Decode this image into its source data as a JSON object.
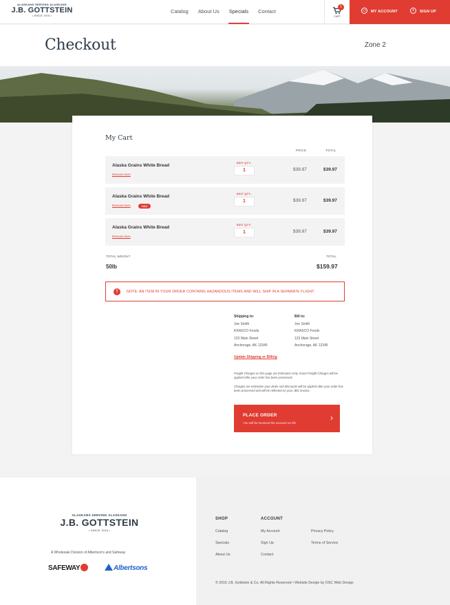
{
  "header": {
    "logo": {
      "tagline": "ALASKANS SERVING ALASKANS",
      "name": "J.B. GOTTSTEIN",
      "since": "• SINCE 1916 •"
    },
    "nav": [
      {
        "label": "Catalog",
        "active": false
      },
      {
        "label": "About Us",
        "active": false
      },
      {
        "label": "Specials",
        "active": true
      },
      {
        "label": "Contact",
        "active": false
      }
    ],
    "cart": {
      "count": "1",
      "label": "CART",
      "icon": "cart-icon"
    },
    "my_account": {
      "label": "MY ACCOUNT",
      "icon": "user-icon"
    },
    "sign_up": {
      "label": "SIGN UP",
      "icon": "plus-circle-icon"
    },
    "accent_color": "#e03c31"
  },
  "page": {
    "title": "Checkout",
    "zone": "Zone 2"
  },
  "cart": {
    "title": "My Cart",
    "columns": {
      "price": "PRICE",
      "total": "TOTAL"
    },
    "items": [
      {
        "name": "Alaska Grains White Bread",
        "remove": "Remove Item",
        "qty_label": "EDIT QTY:",
        "qty": "1",
        "price": "$39.97",
        "total": "$39.97",
        "haz": ""
      },
      {
        "name": "Alaska Grains White Bread",
        "remove": "Remove Item",
        "qty_label": "EDIT QTY:",
        "qty": "1",
        "price": "$39.97",
        "total": "$39.97",
        "haz": "HAZ"
      },
      {
        "name": "Alaska Grains White Bread",
        "remove": "Remove Item",
        "qty_label": "EDIT QTY:",
        "qty": "1",
        "price": "$39.97",
        "total": "$39.97",
        "haz": ""
      }
    ],
    "weight_label": "TOTAL WEIGHT",
    "weight": "50lb",
    "total_label": "TOTAL",
    "total": "$159.97"
  },
  "notice": {
    "icon": "alert-icon",
    "text": "NOTE: AN ITEM IN YOUR ORDER CONTAINS HAZARDOUS ITEMS AND WILL SHIP IN A SEPARATE FLIGHT."
  },
  "shipping": {
    "heading": "Shipping to:",
    "name": "Joe Smith",
    "company": "KRASCO Foods",
    "street": "123 Main Street",
    "city": "Anchorage, AK 12345"
  },
  "billing": {
    "heading": "Bill to:",
    "name": "Joe Smith",
    "company": "KRASCO Foods",
    "street": "123 Main Street",
    "city": "Anchorage, AK 12345"
  },
  "update_link": "Update Shipping or Billing",
  "fine_print": [
    "Freight Charges on this page are Estimates Only. Exact Freight Charges will be applied after your order has been processed.",
    "Charges are estimates your deals and discounts will be applied after your order has been processed and will be reflected on your JBG invoice."
  ],
  "place_order": {
    "label": "PLACE ORDER",
    "sub": "You will be invoiced the account on file."
  },
  "footer": {
    "logo": {
      "tagline": "ALASKANS SERVING ALASKANS",
      "name": "J.B. GOTTSTEIN",
      "since": "• SINCE 1916 •"
    },
    "division": "A Wholesale Division of Albertson's and Safeway",
    "safeway": "SAFEWAY",
    "albertsons": "Albertsons",
    "shop_heading": "SHOP",
    "shop_links": [
      "Catalog",
      "Specials",
      "About Us"
    ],
    "account_heading": "ACCOUNT",
    "account_links": [
      "My Account",
      "Sign Up",
      "Contact"
    ],
    "legal_links": [
      "Privacy Policy",
      "Terms of Service"
    ],
    "copyright": "© 2016 J.B. Gottstein & Co. All Rights Reserved • Website Design by OSC Web Design"
  }
}
